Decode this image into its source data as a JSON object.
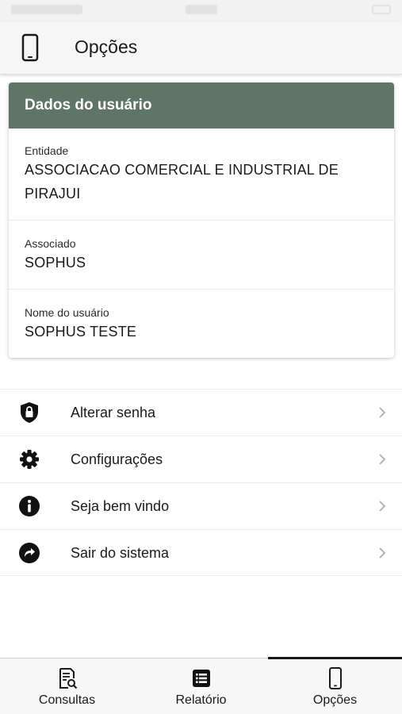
{
  "header": {
    "title": "Opções",
    "icon": "phone-icon"
  },
  "user_card": {
    "title": "Dados do usuário",
    "fields": [
      {
        "label": "Entidade",
        "value": "ASSOCIACAO COMERCIAL E INDUSTRIAL DE PIRAJUI"
      },
      {
        "label": "Associado",
        "value": "SOPHUS"
      },
      {
        "label": "Nome do usuário",
        "value": "SOPHUS TESTE"
      }
    ],
    "header_color": "#5f7568"
  },
  "menu": {
    "items": [
      {
        "label": "Alterar senha",
        "icon": "shield-lock-icon"
      },
      {
        "label": "Configurações",
        "icon": "gear-icon"
      },
      {
        "label": "Seja bem vindo",
        "icon": "info-icon"
      },
      {
        "label": "Sair do sistema",
        "icon": "share-arrow-icon"
      }
    ]
  },
  "tabbar": {
    "tabs": [
      {
        "label": "Consultas",
        "icon": "document-search-icon"
      },
      {
        "label": "Relatório",
        "icon": "list-icon"
      },
      {
        "label": "Opções",
        "icon": "phone-icon"
      }
    ],
    "active": "Opções"
  }
}
